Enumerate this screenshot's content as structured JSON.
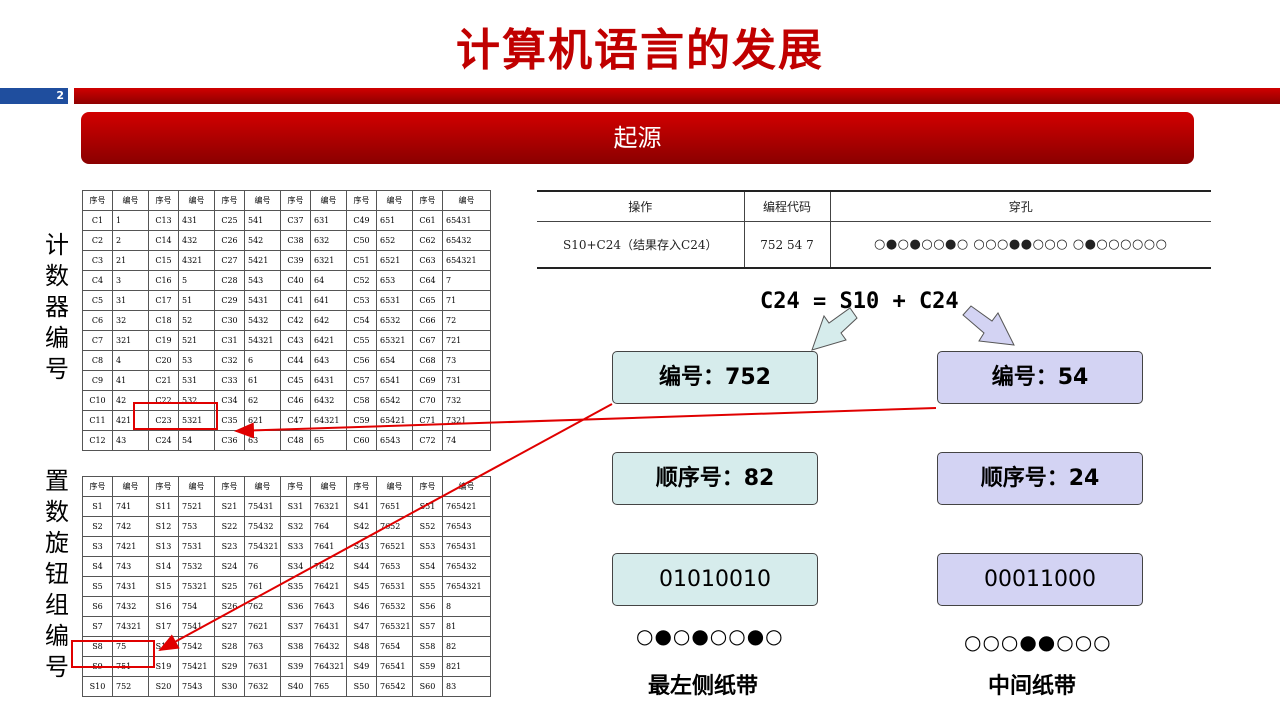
{
  "page": {
    "title": "计算机语言的发展",
    "number": "2",
    "banner": "起源"
  },
  "labels": {
    "counter": "计数器编号",
    "switch": "置数旋钮组编号"
  },
  "counter_table": {
    "headers": [
      "序号",
      "编号",
      "序号",
      "编号",
      "序号",
      "编号",
      "序号",
      "编号",
      "序号",
      "编号",
      "序号",
      "编号"
    ],
    "rows": [
      [
        "C1",
        "1",
        "C13",
        "431",
        "C25",
        "541",
        "C37",
        "631",
        "C49",
        "651",
        "C61",
        "65431"
      ],
      [
        "C2",
        "2",
        "C14",
        "432",
        "C26",
        "542",
        "C38",
        "632",
        "C50",
        "652",
        "C62",
        "65432"
      ],
      [
        "C3",
        "21",
        "C15",
        "4321",
        "C27",
        "5421",
        "C39",
        "6321",
        "C51",
        "6521",
        "C63",
        "654321"
      ],
      [
        "C4",
        "3",
        "C16",
        "5",
        "C28",
        "543",
        "C40",
        "64",
        "C52",
        "653",
        "C64",
        "7"
      ],
      [
        "C5",
        "31",
        "C17",
        "51",
        "C29",
        "5431",
        "C41",
        "641",
        "C53",
        "6531",
        "C65",
        "71"
      ],
      [
        "C6",
        "32",
        "C18",
        "52",
        "C30",
        "5432",
        "C42",
        "642",
        "C54",
        "6532",
        "C66",
        "72"
      ],
      [
        "C7",
        "321",
        "C19",
        "521",
        "C31",
        "54321",
        "C43",
        "6421",
        "C55",
        "65321",
        "C67",
        "721"
      ],
      [
        "C8",
        "4",
        "C20",
        "53",
        "C32",
        "6",
        "C44",
        "643",
        "C56",
        "654",
        "C68",
        "73"
      ],
      [
        "C9",
        "41",
        "C21",
        "531",
        "C33",
        "61",
        "C45",
        "6431",
        "C57",
        "6541",
        "C69",
        "731"
      ],
      [
        "C10",
        "42",
        "C22",
        "532",
        "C34",
        "62",
        "C46",
        "6432",
        "C58",
        "6542",
        "C70",
        "732"
      ],
      [
        "C11",
        "421",
        "C23",
        "5321",
        "C35",
        "621",
        "C47",
        "64321",
        "C59",
        "65421",
        "C71",
        "7321"
      ],
      [
        "C12",
        "43",
        "C24",
        "54",
        "C36",
        "63",
        "C48",
        "65",
        "C60",
        "6543",
        "C72",
        "74"
      ]
    ]
  },
  "switch_table": {
    "headers": [
      "序号",
      "编号",
      "序号",
      "编号",
      "序号",
      "编号",
      "序号",
      "编号",
      "序号",
      "编号",
      "序号",
      "编号"
    ],
    "rows": [
      [
        "S1",
        "741",
        "S11",
        "7521",
        "S21",
        "75431",
        "S31",
        "76321",
        "S41",
        "7651",
        "S51",
        "765421"
      ],
      [
        "S2",
        "742",
        "S12",
        "753",
        "S22",
        "75432",
        "S32",
        "764",
        "S42",
        "7652",
        "S52",
        "76543"
      ],
      [
        "S3",
        "7421",
        "S13",
        "7531",
        "S23",
        "754321",
        "S33",
        "7641",
        "S43",
        "76521",
        "S53",
        "765431"
      ],
      [
        "S4",
        "743",
        "S14",
        "7532",
        "S24",
        "76",
        "S34",
        "7642",
        "S44",
        "7653",
        "S54",
        "765432"
      ],
      [
        "S5",
        "7431",
        "S15",
        "75321",
        "S25",
        "761",
        "S35",
        "76421",
        "S45",
        "76531",
        "S55",
        "7654321"
      ],
      [
        "S6",
        "7432",
        "S16",
        "754",
        "S26",
        "762",
        "S36",
        "7643",
        "S46",
        "76532",
        "S56",
        "8"
      ],
      [
        "S7",
        "74321",
        "S17",
        "7541",
        "S27",
        "7621",
        "S37",
        "76431",
        "S47",
        "765321",
        "S57",
        "81"
      ],
      [
        "S8",
        "75",
        "S18",
        "7542",
        "S28",
        "763",
        "S38",
        "76432",
        "S48",
        "7654",
        "S58",
        "82"
      ],
      [
        "S9",
        "751",
        "S19",
        "75421",
        "S29",
        "7631",
        "S39",
        "764321",
        "S49",
        "76541",
        "S59",
        "821"
      ],
      [
        "S10",
        "752",
        "S20",
        "7543",
        "S30",
        "7632",
        "S40",
        "765",
        "S50",
        "76542",
        "S60",
        "83"
      ]
    ]
  },
  "op_table": {
    "headers": [
      "操作",
      "编程代码",
      "穿孔"
    ],
    "row": [
      "S10+C24（结果存入C24）",
      "752 54 7",
      "○●○●○○●○ ○○○●●○○○ ○●○○○○○○"
    ]
  },
  "formula": "C24 = S10 + C24",
  "left_col": {
    "code_box": "编号：752",
    "seq_box": "顺序号：82",
    "binary_box": "01010010",
    "dots": "○●○●○○●○",
    "caption": "最左侧纸带"
  },
  "right_col": {
    "code_box": "编号：54",
    "seq_box": "顺序号：24",
    "binary_box": "00011000",
    "dots": "○○○●●○○○",
    "caption": "中间纸带"
  },
  "colors": {
    "title": "#c00000",
    "accent_blue": "#1f4e9e",
    "highlight_red": "#e00000",
    "cyan_box": "#d6ecec",
    "lavender_box": "#d3d3f3"
  }
}
